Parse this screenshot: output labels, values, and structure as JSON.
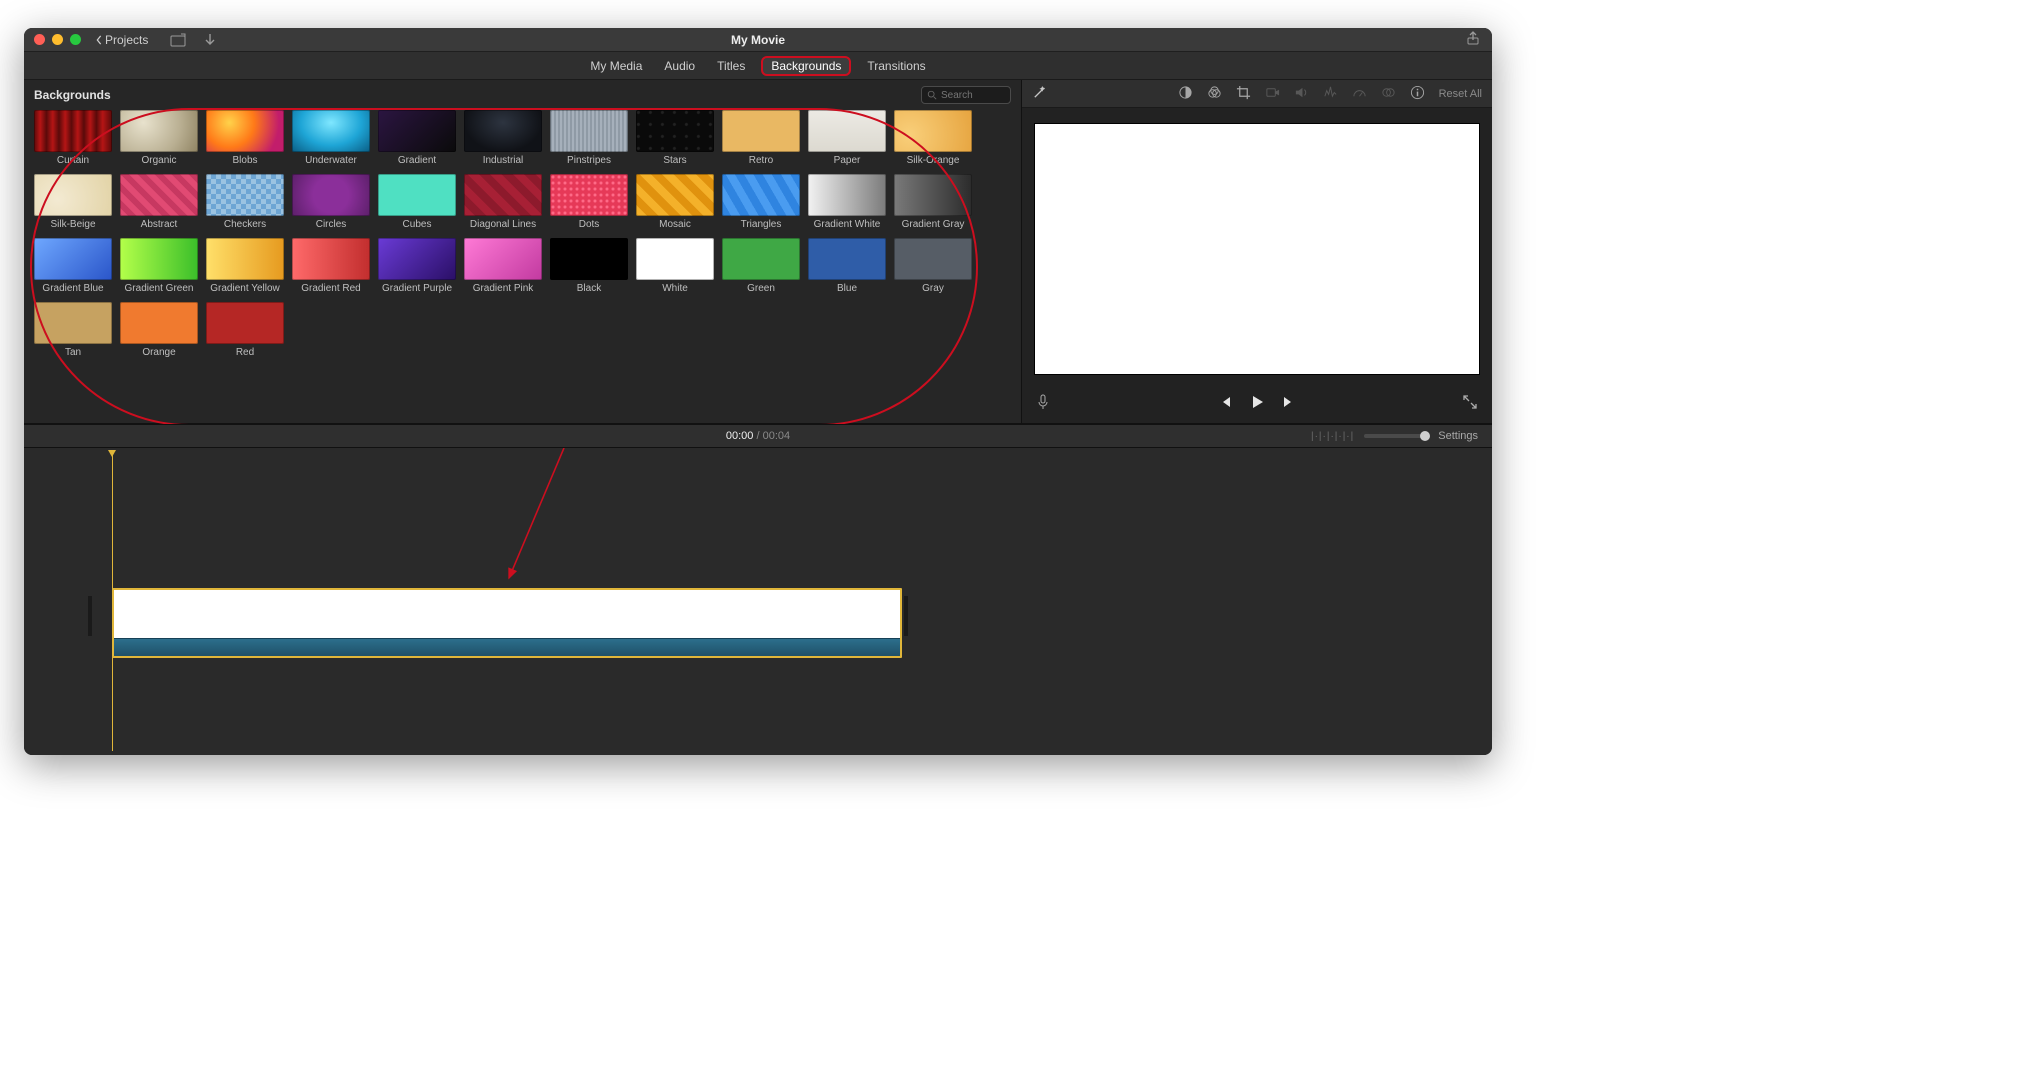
{
  "titlebar": {
    "back_label": "Projects",
    "window_title": "My Movie"
  },
  "tabs": {
    "my_media": "My Media",
    "audio": "Audio",
    "titles": "Titles",
    "backgrounds": "Backgrounds",
    "transitions": "Transitions"
  },
  "viewer": {
    "reset_label": "Reset All"
  },
  "browser": {
    "heading": "Backgrounds",
    "search_placeholder": "Search",
    "items": [
      {
        "label": "Curtain",
        "cls": "p-curtain"
      },
      {
        "label": "Organic",
        "cls": "p-organic"
      },
      {
        "label": "Blobs",
        "cls": "p-blobs"
      },
      {
        "label": "Underwater",
        "cls": "p-underwater"
      },
      {
        "label": "Gradient",
        "cls": "p-gradient"
      },
      {
        "label": "Industrial",
        "cls": "p-industrial"
      },
      {
        "label": "Pinstripes",
        "cls": "p-pinstripes"
      },
      {
        "label": "Stars",
        "cls": "p-stars"
      },
      {
        "label": "Retro",
        "cls": "p-retro"
      },
      {
        "label": "Paper",
        "cls": "p-paper"
      },
      {
        "label": "Silk-Orange",
        "cls": "p-silk-orange"
      },
      {
        "label": "Silk-Beige",
        "cls": "p-silk-beige"
      },
      {
        "label": "Abstract",
        "cls": "p-abstract"
      },
      {
        "label": "Checkers",
        "cls": "p-checkers"
      },
      {
        "label": "Circles",
        "cls": "p-circles"
      },
      {
        "label": "Cubes",
        "cls": "p-cubes"
      },
      {
        "label": "Diagonal Lines",
        "cls": "p-diag"
      },
      {
        "label": "Dots",
        "cls": "p-dots"
      },
      {
        "label": "Mosaic",
        "cls": "p-mosaic"
      },
      {
        "label": "Triangles",
        "cls": "p-tri"
      },
      {
        "label": "Gradient White",
        "cls": "p-gwhite"
      },
      {
        "label": "Gradient Gray",
        "cls": "p-ggray"
      },
      {
        "label": "Gradient Blue",
        "cls": "p-gblue"
      },
      {
        "label": "Gradient Green",
        "cls": "p-ggreen"
      },
      {
        "label": "Gradient Yellow",
        "cls": "p-gyellow"
      },
      {
        "label": "Gradient Red",
        "cls": "p-gred"
      },
      {
        "label": "Gradient Purple",
        "cls": "p-gpurple"
      },
      {
        "label": "Gradient Pink",
        "cls": "p-gpink"
      },
      {
        "label": "Black",
        "cls": "p-black"
      },
      {
        "label": "White",
        "cls": "p-white"
      },
      {
        "label": "Green",
        "cls": "p-green"
      },
      {
        "label": "Blue",
        "cls": "p-blue"
      },
      {
        "label": "Gray",
        "cls": "p-gray"
      },
      {
        "label": "Tan",
        "cls": "p-tan"
      },
      {
        "label": "Orange",
        "cls": "p-orange"
      },
      {
        "label": "Red",
        "cls": "p-red"
      }
    ]
  },
  "infobar": {
    "current_time": "00:00",
    "duration": "00:04",
    "separator": " / ",
    "settings_label": "Settings"
  },
  "colors": {
    "annotation": "#cc0e1f",
    "playhead": "#e0b63a"
  }
}
